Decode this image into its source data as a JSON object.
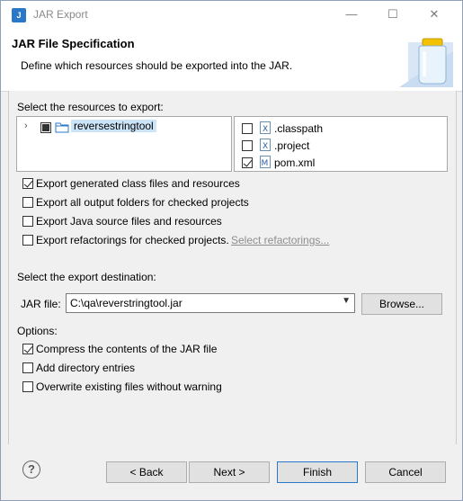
{
  "window": {
    "title": "JAR Export",
    "app_icon": "jar-icon",
    "controls": {
      "minimize": "—",
      "maximize": "☐",
      "close": "✕"
    }
  },
  "header": {
    "title": "JAR File Specification",
    "description": "Define which resources should be exported into the JAR."
  },
  "resources": {
    "label": "Select the resources to export:",
    "tree": [
      {
        "label": "reversestringtool",
        "state": "partial",
        "icon": "project-folder-icon"
      }
    ],
    "files": [
      {
        "label": ".classpath",
        "checked": false,
        "icon": "xml-file-icon"
      },
      {
        "label": ".project",
        "checked": false,
        "icon": "xml-file-icon"
      },
      {
        "label": "pom.xml",
        "checked": true,
        "icon": "maven-file-icon"
      }
    ]
  },
  "export_options": [
    {
      "label": "Export generated class files and resources",
      "checked": true
    },
    {
      "label": "Export all output folders for checked projects",
      "checked": false
    },
    {
      "label": "Export Java source files and resources",
      "checked": false
    },
    {
      "label": "Export refactorings for checked projects.",
      "checked": false
    }
  ],
  "select_refactorings_link": "Select refactorings...",
  "destination": {
    "label": "Select the export destination:",
    "jar_file_label": "JAR file:",
    "jar_file_value": "C:\\qa\\reverstringtool.jar",
    "browse": "Browse..."
  },
  "options": {
    "label": "Options:",
    "items": [
      {
        "label": "Compress the contents of the JAR file",
        "checked": true
      },
      {
        "label": "Add directory entries",
        "checked": false
      },
      {
        "label": "Overwrite existing files without warning",
        "checked": false
      }
    ]
  },
  "footer": {
    "help": "?",
    "back": "< Back",
    "next": "Next >",
    "finish": "Finish",
    "cancel": "Cancel"
  }
}
